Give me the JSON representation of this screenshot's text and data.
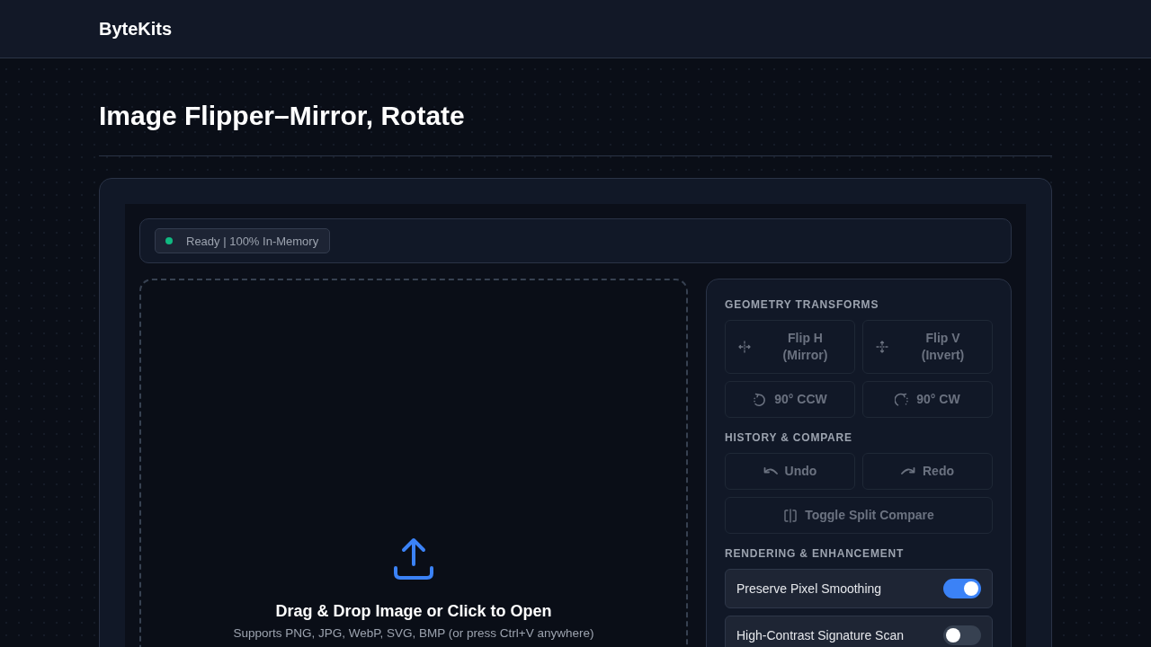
{
  "header": {
    "brand": "ByteKits"
  },
  "page": {
    "title": "Image Flipper–Mirror, Rotate"
  },
  "status": {
    "label": "Ready | 100% In-Memory"
  },
  "dropzone": {
    "title": "Drag & Drop Image or Click to Open",
    "hint": "Supports PNG, JPG, WebP, SVG, BMP (or press Ctrl+V anywhere)"
  },
  "sections": [
    {
      "heading": "GEOMETRY TRANSFORMS",
      "kind": "buttons",
      "items": [
        {
          "label": "Flip H (Mirror)",
          "disabled": true
        },
        {
          "label": "Flip V (Invert)",
          "disabled": true
        },
        {
          "label": "90° CCW",
          "disabled": true
        },
        {
          "label": "90° CW",
          "disabled": true
        }
      ]
    },
    {
      "heading": "HISTORY & COMPARE",
      "kind": "buttons",
      "items": [
        {
          "label": "Undo",
          "disabled": true
        },
        {
          "label": "Redo",
          "disabled": true
        },
        {
          "label": "Toggle Split Compare",
          "disabled": true
        }
      ]
    },
    {
      "heading": "RENDERING & ENHANCEMENT",
      "kind": "toggles",
      "items": [
        {
          "label": "Preserve Pixel Smoothing",
          "on": true
        },
        {
          "label": "High-Contrast Signature Scan",
          "on": false
        }
      ]
    }
  ]
}
